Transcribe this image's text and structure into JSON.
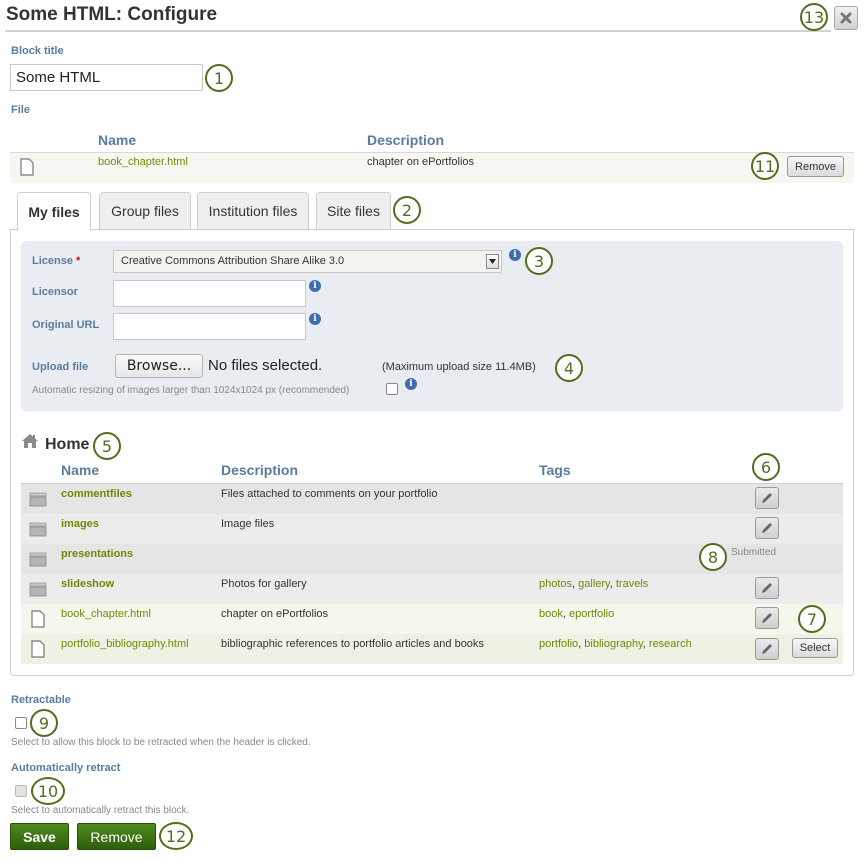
{
  "header": {
    "title": "Some HTML: Configure",
    "close_icon": "close-icon"
  },
  "block_title": {
    "label": "Block title",
    "value": "Some HTML"
  },
  "file_section": {
    "label": "File",
    "columns": [
      "Name",
      "Description"
    ],
    "selected_file": {
      "icon": "file-icon",
      "name": "book_chapter.html",
      "description": "chapter on ePortfolios",
      "remove_label": "Remove"
    }
  },
  "tabs": [
    {
      "label": "My files",
      "active": true
    },
    {
      "label": "Group files",
      "active": false
    },
    {
      "label": "Institution files",
      "active": false
    },
    {
      "label": "Site files",
      "active": false
    }
  ],
  "upload_form": {
    "license_label": "License",
    "license_required_mark": "*",
    "license_value": "Creative Commons Attribution Share Alike 3.0",
    "licensor_label": "Licensor",
    "licensor_value": "",
    "original_url_label": "Original URL",
    "original_url_value": "",
    "upload_label": "Upload file",
    "browse_label": "Browse...",
    "no_file_text": "No files selected.",
    "max_size_text": "(Maximum upload size 11.4MB)",
    "resize_text": "Automatic resizing of images larger than 1024x1024 px (recommended)",
    "resize_checked": false
  },
  "browser": {
    "home_icon": "home-icon",
    "folder_title": "Home",
    "columns": [
      "Name",
      "Description",
      "Tags"
    ],
    "rows": [
      {
        "type": "folder",
        "name": "commentfiles",
        "description": "Files attached to comments on your portfolio",
        "tags": [],
        "editable": true,
        "status": "",
        "selectable": false
      },
      {
        "type": "folder",
        "name": "images",
        "description": "Image files",
        "tags": [],
        "editable": true,
        "status": "",
        "selectable": false
      },
      {
        "type": "folder",
        "name": "presentations",
        "description": "",
        "tags": [],
        "editable": false,
        "status": "Submitted",
        "selectable": false
      },
      {
        "type": "folder",
        "name": "slideshow",
        "description": "Photos for gallery",
        "tags": [
          "photos",
          "gallery",
          "travels"
        ],
        "editable": true,
        "status": "",
        "selectable": false
      },
      {
        "type": "file",
        "name": "book_chapter.html",
        "description": "chapter on ePortfolios",
        "tags": [
          "book",
          "eportfolio"
        ],
        "editable": true,
        "status": "",
        "selectable": false
      },
      {
        "type": "file",
        "name": "portfolio_bibliography.html",
        "description": "bibliographic references to portfolio articles and books",
        "tags": [
          "portfolio",
          "bibliography",
          "research"
        ],
        "editable": true,
        "status": "",
        "selectable": true
      }
    ],
    "select_label": "Select"
  },
  "retractable": {
    "label": "Retractable",
    "checked": false,
    "help": "Select to allow this block to be retracted when the header is clicked."
  },
  "auto_retract": {
    "label": "Automatically retract",
    "checked": false,
    "disabled": true,
    "help": "Select to automatically retract this block."
  },
  "actions": {
    "save_label": "Save",
    "remove_label": "Remove"
  },
  "callouts": [
    "1",
    "2",
    "3",
    "4",
    "5",
    "6",
    "7",
    "8",
    "9",
    "10",
    "11",
    "12",
    "13"
  ],
  "colors": {
    "label_blue": "#5a7ca1",
    "link_green": "#6d8a05",
    "callout_green": "#4f6f1e",
    "button_green": "#3d7015",
    "info_blue": "#3d6fb0"
  }
}
